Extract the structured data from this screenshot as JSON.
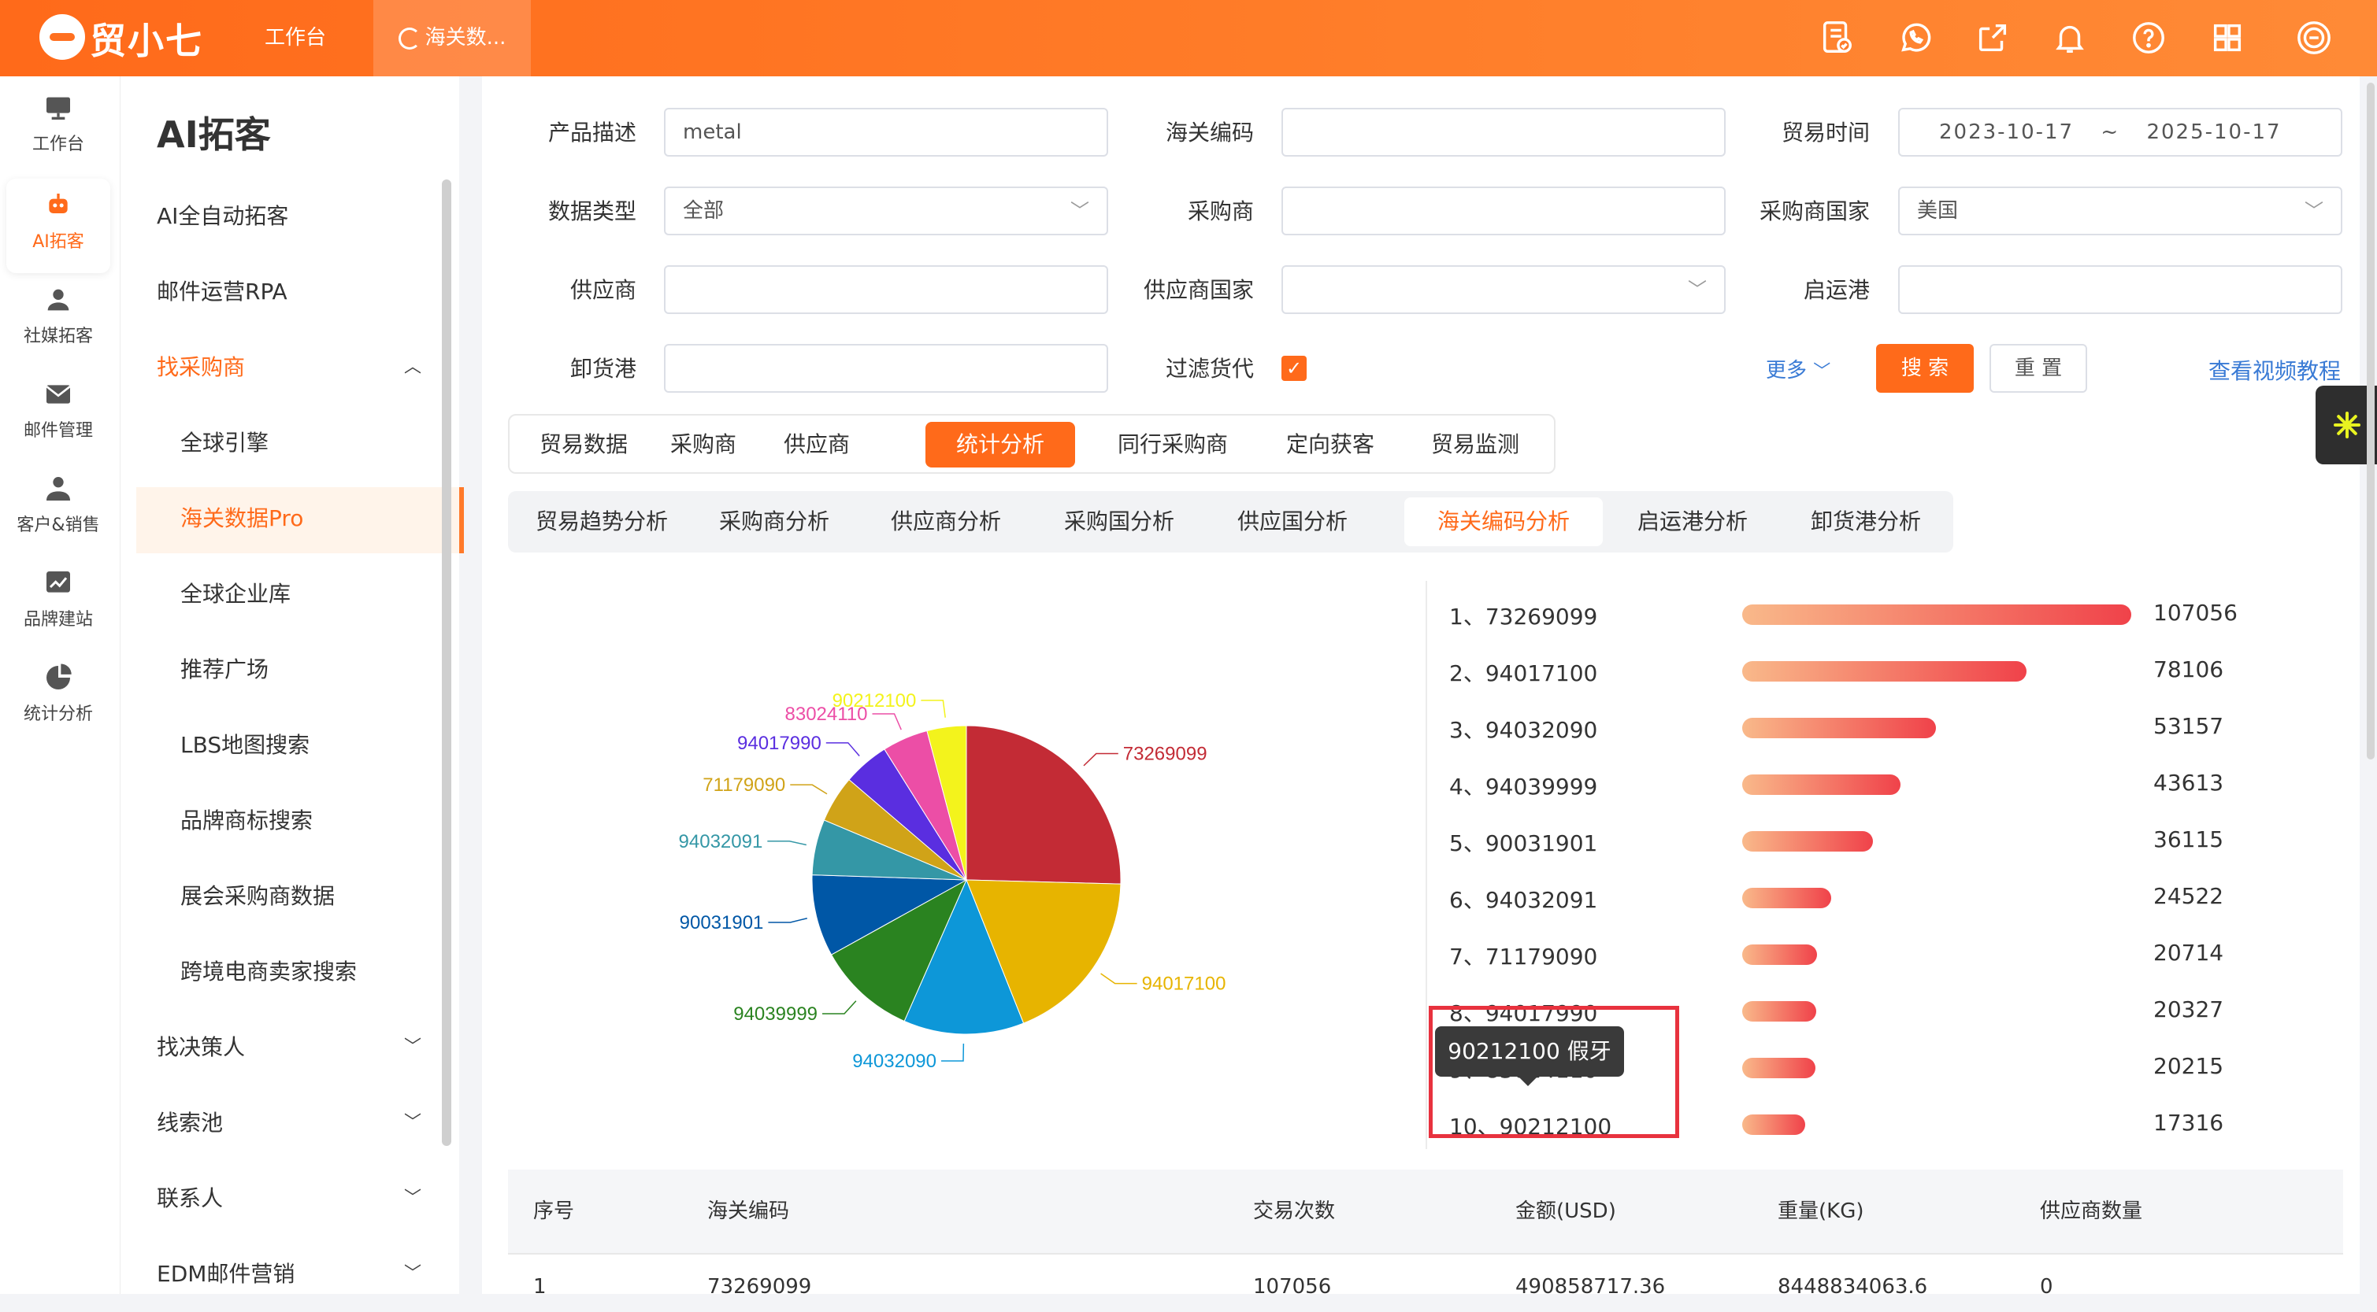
{
  "app": {
    "name": "贸小七"
  },
  "header": {
    "tabs": [
      {
        "label": "工作台"
      },
      {
        "label": "海关数..."
      }
    ],
    "icons": [
      "document-check-icon",
      "whatsapp-icon",
      "export-icon",
      "bell-icon",
      "help-icon",
      "grid-icon",
      "avatar-icon"
    ]
  },
  "sidebar": {
    "items": [
      {
        "label": "工作台",
        "icon": "monitor-icon"
      },
      {
        "label": "AI拓客",
        "icon": "robot-icon"
      },
      {
        "label": "社媒拓客",
        "icon": "person-icon"
      },
      {
        "label": "邮件管理",
        "icon": "mail-icon"
      },
      {
        "label": "客户&销售",
        "icon": "customer-icon"
      },
      {
        "label": "品牌建站",
        "icon": "chart-icon"
      },
      {
        "label": "统计分析",
        "icon": "pie-icon"
      }
    ]
  },
  "submenu": {
    "title": "AI拓客",
    "items": [
      {
        "label": "AI全自动拓客"
      },
      {
        "label": "邮件运营RPA"
      },
      {
        "label": "找采购商"
      },
      {
        "label": "全球引擎"
      },
      {
        "label": "海关数据Pro"
      },
      {
        "label": "全球企业库"
      },
      {
        "label": "推荐广场"
      },
      {
        "label": "LBS地图搜索"
      },
      {
        "label": "品牌商标搜索"
      },
      {
        "label": "展会采购商数据"
      },
      {
        "label": "跨境电商卖家搜索"
      },
      {
        "label": "找决策人"
      },
      {
        "label": "线索池"
      },
      {
        "label": "联系人"
      },
      {
        "label": "EDM邮件营销"
      }
    ]
  },
  "form": {
    "product_label": "产品描述",
    "product_value": "metal",
    "hscode_label": "海关编码",
    "hscode_value": "",
    "trade_time_label": "贸易时间",
    "date_from": "2023-10-17",
    "date_sep": "~",
    "date_to": "2025-10-17",
    "data_type_label": "数据类型",
    "data_type_value": "全部",
    "buyer_label": "采购商",
    "buyer_value": "",
    "buyer_country_label": "采购商国家",
    "buyer_country_value": "美国",
    "supplier_label": "供应商",
    "supplier_value": "",
    "supplier_country_label": "供应商国家",
    "supplier_country_value": "",
    "origin_port_label": "启运港",
    "origin_port_value": "",
    "dest_port_label": "卸货港",
    "dest_port_value": "",
    "filter_forwarder_label": "过滤货代",
    "filter_forwarder_checked": true,
    "more_label": "更多",
    "search_label": "搜 索",
    "reset_label": "重 置",
    "video_link": "查看视频教程"
  },
  "tabs_primary": [
    {
      "label": "贸易数据"
    },
    {
      "label": "采购商"
    },
    {
      "label": "供应商"
    },
    {
      "label": "统计分析",
      "active": true
    },
    {
      "label": "同行采购商"
    },
    {
      "label": "定向获客"
    },
    {
      "label": "贸易监测"
    }
  ],
  "tabs_secondary": [
    {
      "label": "贸易趋势分析"
    },
    {
      "label": "采购商分析"
    },
    {
      "label": "供应商分析"
    },
    {
      "label": "采购国分析"
    },
    {
      "label": "供应国分析"
    },
    {
      "label": "海关编码分析",
      "active": true
    },
    {
      "label": "启运港分析"
    },
    {
      "label": "卸货港分析"
    }
  ],
  "chart_data": {
    "type": "pie",
    "labels": [
      "73269099",
      "94017100",
      "94032090",
      "94039999",
      "90031901",
      "94032091",
      "71179090",
      "94017990",
      "83024110",
      "90212100"
    ],
    "values": [
      107056,
      78106,
      53157,
      43613,
      36115,
      24522,
      20714,
      20327,
      20215,
      17316
    ],
    "colors": [
      "#c32b35",
      "#e7b400",
      "#0d97d8",
      "#2a8320",
      "#0057a6",
      "#3497a6",
      "#d0a318",
      "#5a2ee0",
      "#ec4ea6",
      "#f3f31c"
    ]
  },
  "ranking": {
    "items": [
      {
        "label": "1、73269099",
        "value": "107056",
        "fill": 1.0
      },
      {
        "label": "2、94017100",
        "value": "78106",
        "fill": 0.73
      },
      {
        "label": "3、94032090",
        "value": "53157",
        "fill": 0.497
      },
      {
        "label": "4、94039999",
        "value": "43613",
        "fill": 0.407
      },
      {
        "label": "5、90031901",
        "value": "36115",
        "fill": 0.337
      },
      {
        "label": "6、94032091",
        "value": "24522",
        "fill": 0.229
      },
      {
        "label": "7、71179090",
        "value": "20714",
        "fill": 0.193
      },
      {
        "label": "8、94017990",
        "value": "20327",
        "fill": 0.19
      },
      {
        "label": "9、83024110",
        "value": "20215",
        "fill": 0.189
      },
      {
        "label": "10、90212100",
        "value": "17316",
        "fill": 0.162
      }
    ],
    "tooltip": "90212100 假牙"
  },
  "table": {
    "headers": [
      "序号",
      "海关编码",
      "交易次数",
      "金额(USD)",
      "重量(KG)",
      "供应商数量"
    ],
    "first_row": [
      "1",
      "73269099",
      "107056",
      "490858717.36",
      "8448834063.6",
      "0"
    ]
  }
}
